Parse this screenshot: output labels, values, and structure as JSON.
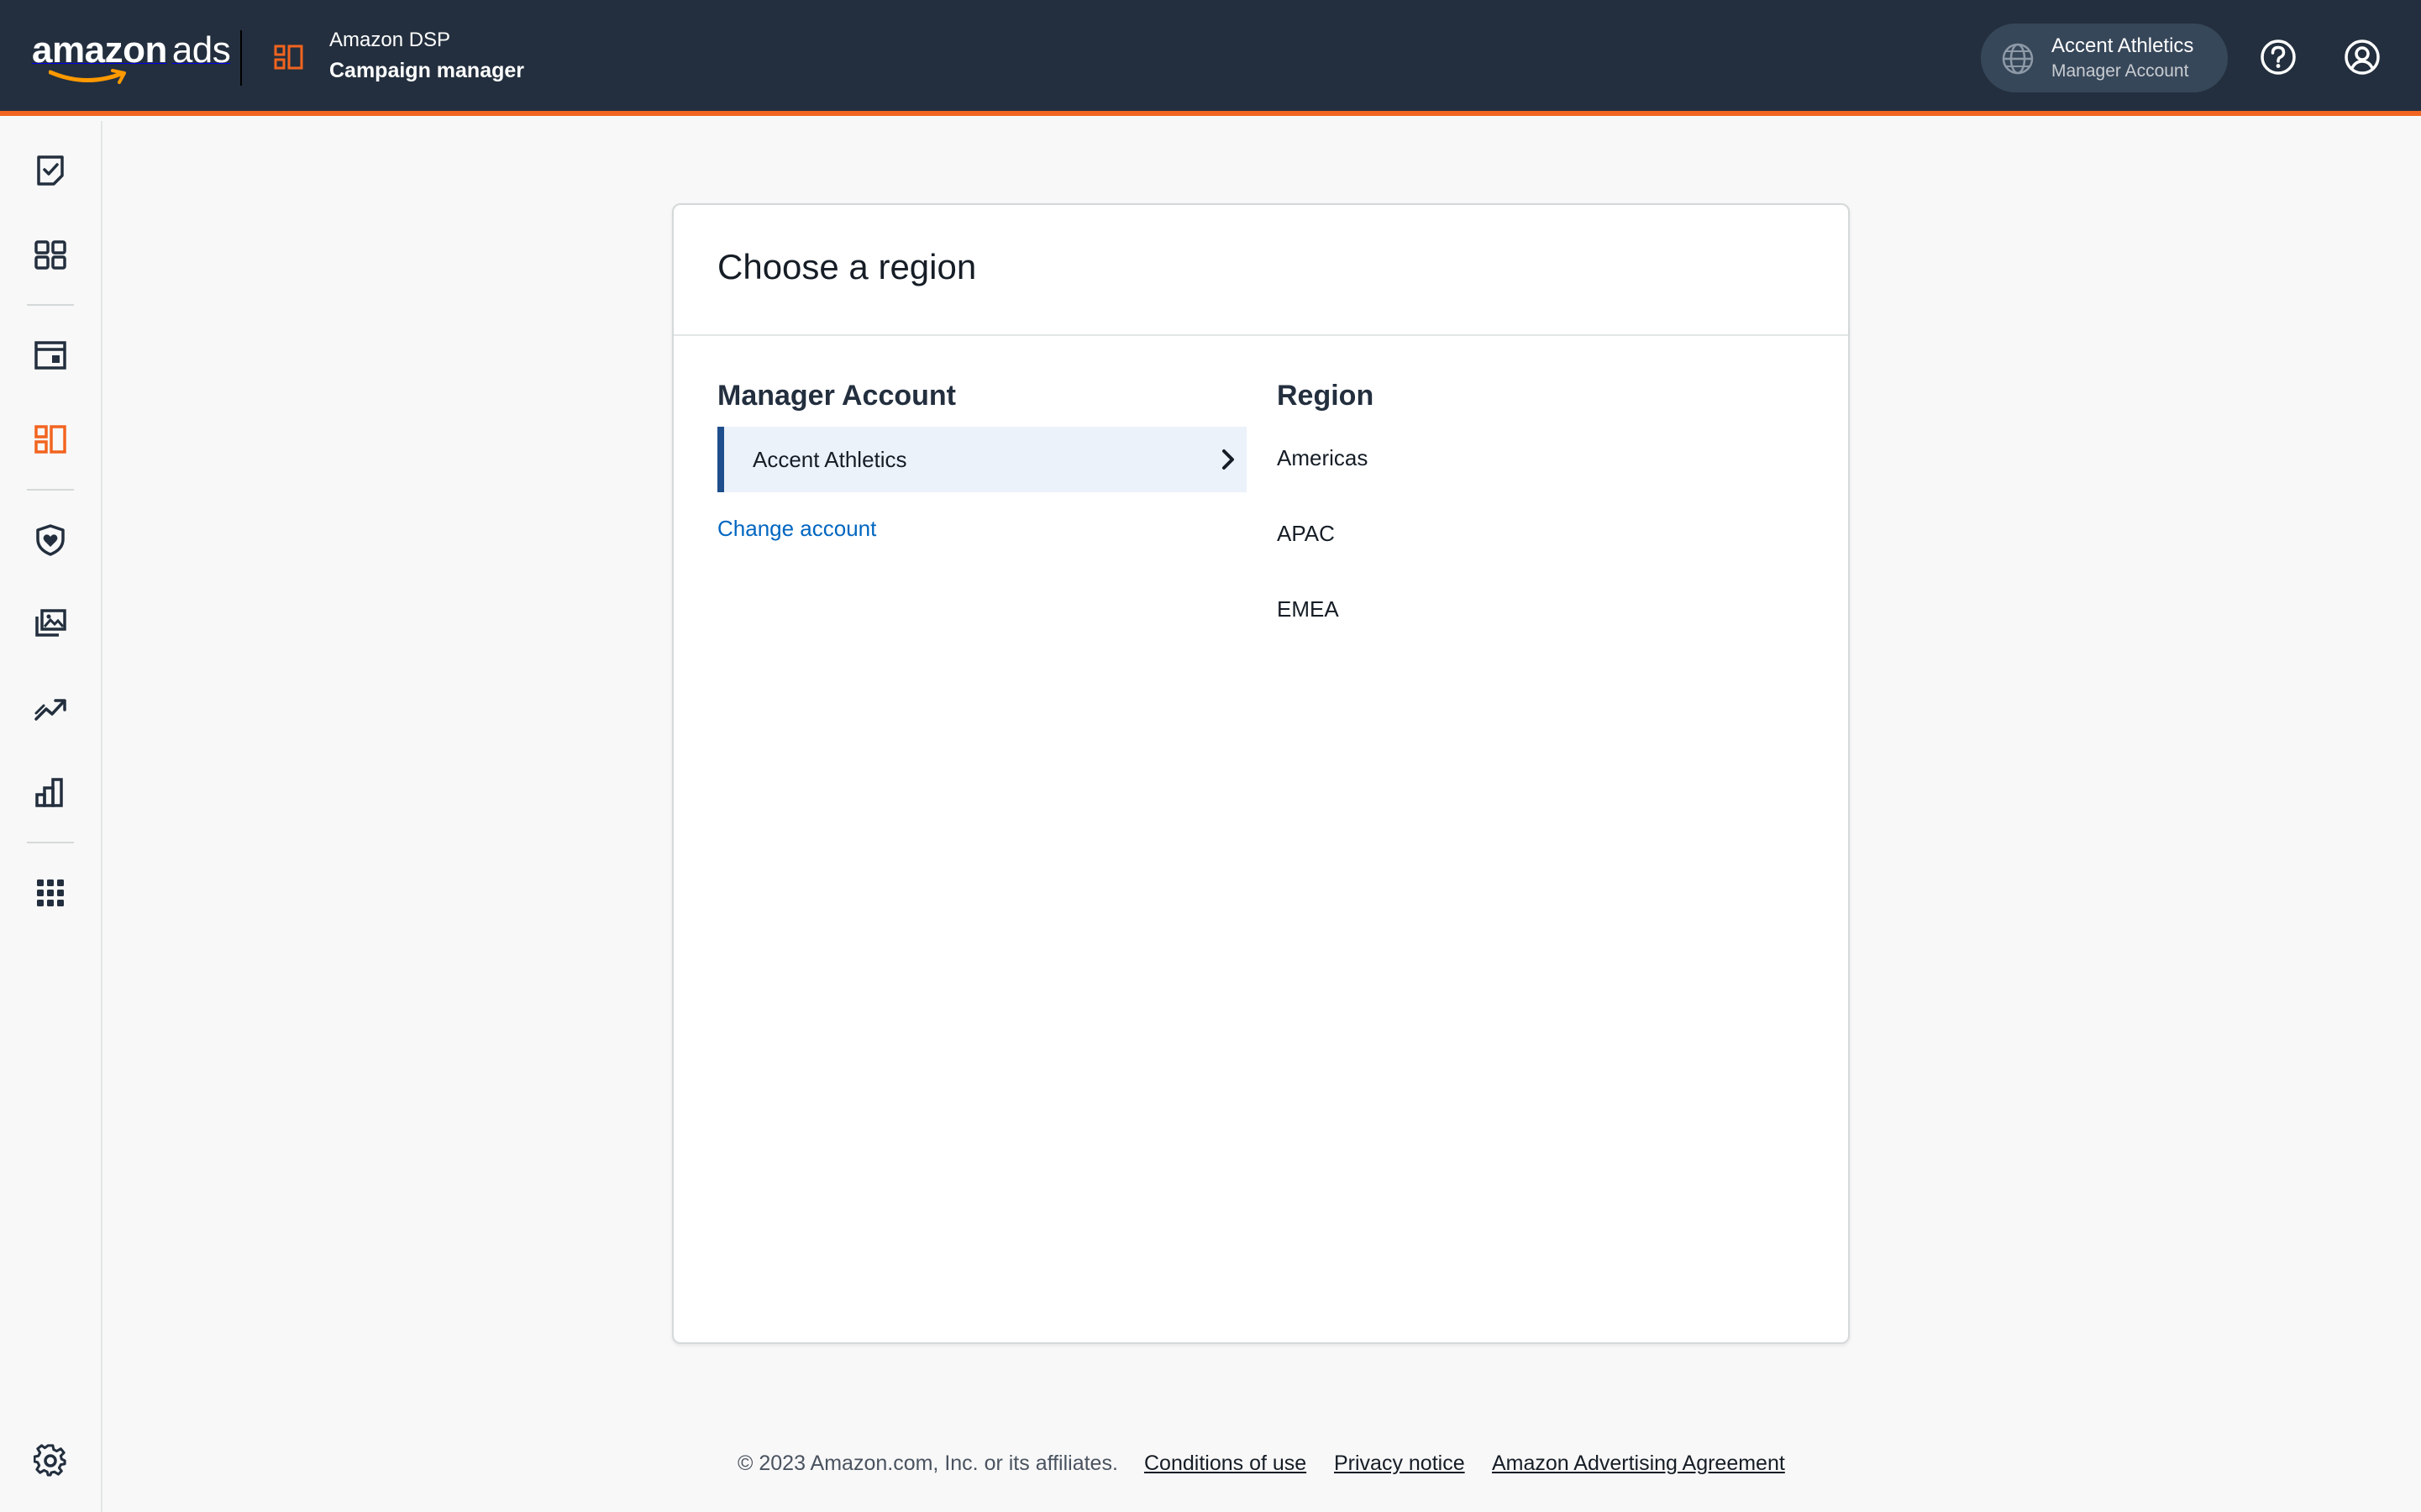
{
  "header": {
    "logo_main": "amazon",
    "logo_suffix": "ads",
    "product_name": "Amazon DSP",
    "product_section": "Campaign manager",
    "account": {
      "name": "Accent Athletics",
      "type": "Manager Account"
    },
    "accent_color": "#f2641f",
    "bar_color": "#232f3e"
  },
  "sidebar": {
    "items": [
      {
        "name": "tasks",
        "icon": "clipboard-check-icon",
        "active": false
      },
      {
        "name": "dashboard",
        "icon": "layout-grid-icon",
        "active": false
      },
      {
        "name": "browser",
        "icon": "window-icon",
        "active": false
      },
      {
        "name": "campaign-manager",
        "icon": "campaign-manager-icon",
        "active": true
      },
      {
        "name": "brand-safety",
        "icon": "shield-heart-icon",
        "active": false
      },
      {
        "name": "creatives",
        "icon": "image-gallery-icon",
        "active": false
      },
      {
        "name": "measurement",
        "icon": "trend-up-icon",
        "active": false
      },
      {
        "name": "reports",
        "icon": "bar-chart-icon",
        "active": false
      },
      {
        "name": "apps",
        "icon": "apps-grid-icon",
        "active": false
      },
      {
        "name": "settings",
        "icon": "gear-icon",
        "active": false
      }
    ],
    "active_color": "#f2641f"
  },
  "card": {
    "title": "Choose a region",
    "manager_heading": "Manager Account",
    "selected_account": "Accent Athletics",
    "change_account": "Change account",
    "region_heading": "Region",
    "regions": [
      "Americas",
      "APAC",
      "EMEA"
    ],
    "selection_color": "#1f4e8c",
    "link_color": "#0066c0"
  },
  "footer": {
    "copyright": "© 2023 Amazon.com, Inc. or its affiliates.",
    "links": [
      "Conditions of use",
      "Privacy notice",
      "Amazon Advertising Agreement"
    ]
  }
}
